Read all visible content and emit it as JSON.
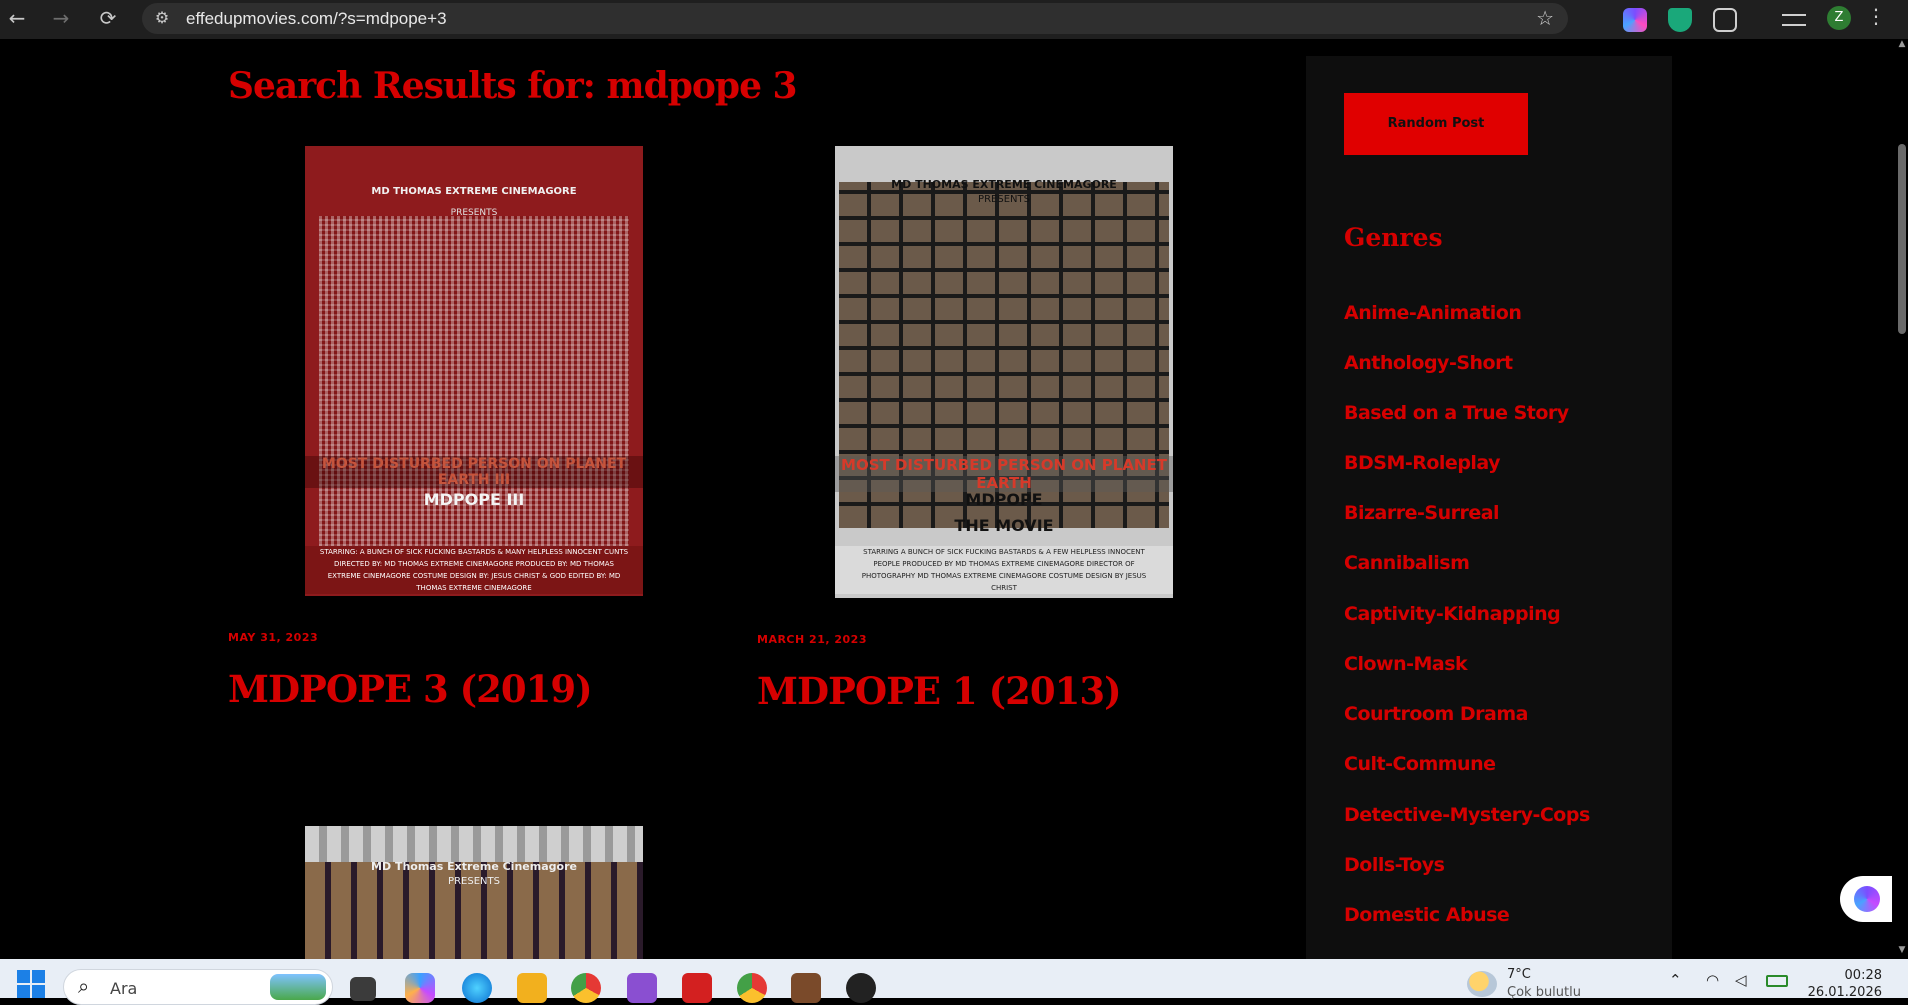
{
  "browser": {
    "url": "effedupmovies.com/?s=mdpope+3",
    "back_icon": "←",
    "forward_icon": "→",
    "reload_icon": "⟳",
    "site_info_icon": "⚙",
    "bookmark_icon": "☆",
    "profile_initial": "Z",
    "menu_icon": "⋮"
  },
  "page": {
    "heading": "Search Results for: mdpope 3",
    "posts": [
      {
        "date": "May 31, 2023",
        "title": "MDPOPE 3 (2019)",
        "poster": {
          "line1": "MD THOMAS EXTREME CINEMAGORE",
          "line2": "PRESENTS",
          "tagline": "MOST DISTURBED PERSON ON PLANET EARTH III",
          "subtitle": "MDPOPE III",
          "credits": "STARRING: A BUNCH OF SICK FUCKING BASTARDS & MANY HELPLESS INNOCENT CUNTS   DIRECTED BY: MD THOMAS EXTREME CINEMAGORE   PRODUCED BY: MD THOMAS EXTREME CINEMAGORE   COSTUME DESIGN BY: JESUS CHRIST & GOD   EDITED BY: MD THOMAS EXTREME CINEMAGORE"
        }
      },
      {
        "date": "March 21, 2023",
        "title": "MDPOPE 1 (2013)",
        "poster": {
          "line1": "MD THOMAS EXTREME CINEMAGORE",
          "line2": "PRESENTS",
          "tagline": "MOST DISTURBED PERSON ON PLANET EARTH",
          "subtitle": "MDPOPE",
          "subtitle2": "THE MOVIE",
          "credits": "STARRING A BUNCH OF SICK FUCKING BASTARDS & A FEW HELPLESS INNOCENT PEOPLE   PRODUCED BY MD THOMAS EXTREME CINEMAGORE   DIRECTOR OF PHOTOGRAPHY MD THOMAS EXTREME CINEMAGORE   COSTUME DESIGN BY JESUS CHRIST"
        }
      },
      {
        "poster": {
          "line1": "MD Thomas Extreme Cinemagore",
          "line2": "PRESENTS"
        }
      }
    ]
  },
  "sidebar": {
    "random_button": "Random Post",
    "genres_title": "Genres",
    "genres": [
      "Anime-Animation",
      "Anthology-Short",
      "Based on a True Story",
      "BDSM-Roleplay",
      "Bizarre-Surreal",
      "Cannibalism",
      "Captivity-Kidnapping",
      "Clown-Mask",
      "Courtroom Drama",
      "Cult-Commune",
      "Detective-Mystery-Cops",
      "Dolls-Toys",
      "Domestic Abuse"
    ]
  },
  "taskbar": {
    "search_placeholder": "Ara",
    "temperature": "7°C",
    "weather_condition": "Çok bulutlu",
    "time": "00:28",
    "date": "26.01.2026"
  },
  "colors": {
    "accent_red": "#d60000",
    "button_red": "#e00000",
    "page_bg": "#000000",
    "sidebar_bg": "#0e0e0e"
  }
}
